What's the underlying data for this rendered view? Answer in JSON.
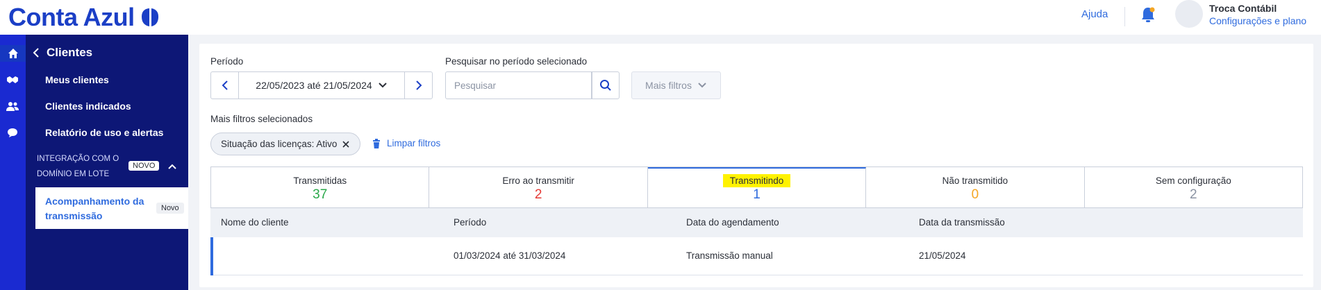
{
  "brand": {
    "name": "Conta Azul",
    "color": "#1b3fc6"
  },
  "header": {
    "help": "Ajuda",
    "company": "Troca Contábil",
    "account_link": "Configurações e plano",
    "notification_icon": "bell-icon"
  },
  "rail": {
    "icons": [
      "home-icon",
      "handshake-icon",
      "users-icon",
      "chat-icon"
    ]
  },
  "sidebar": {
    "title": "Clientes",
    "links": [
      "Meus clientes",
      "Clientes indicados",
      "Relatório de uso e alertas"
    ],
    "section": "INTEGRAÇÃO COM O DOMÍNIO EM LOTE",
    "section_badge": "NOVO",
    "active_item": "Acompanhamento da transmissão",
    "active_badge": "Novo"
  },
  "filters": {
    "period_label": "Período",
    "period_value": "22/05/2023 até 21/05/2024",
    "search_label": "Pesquisar no período selecionado",
    "search_placeholder": "Pesquisar",
    "more_filters": "Mais filtros",
    "selected_label": "Mais filtros selecionados",
    "chip": "Situação das licenças: Ativo",
    "clear": "Limpar filtros"
  },
  "tabs": [
    {
      "label": "Transmitidas",
      "count": "37",
      "color": "#2aa84a"
    },
    {
      "label": "Erro ao transmitir",
      "count": "2",
      "color": "#e53935"
    },
    {
      "label": "Transmitindo",
      "count": "1",
      "color": "#2f6bde"
    },
    {
      "label": "Não transmitido",
      "count": "0",
      "color": "#f5a623"
    },
    {
      "label": "Sem configuração",
      "count": "2",
      "color": "#8b93a3"
    }
  ],
  "table": {
    "columns": [
      "Nome do cliente",
      "Período",
      "Data do agendamento",
      "Data da transmissão"
    ],
    "rows": [
      [
        "",
        "01/03/2024 até 31/03/2024",
        "Transmissão manual",
        "21/05/2024"
      ]
    ]
  }
}
